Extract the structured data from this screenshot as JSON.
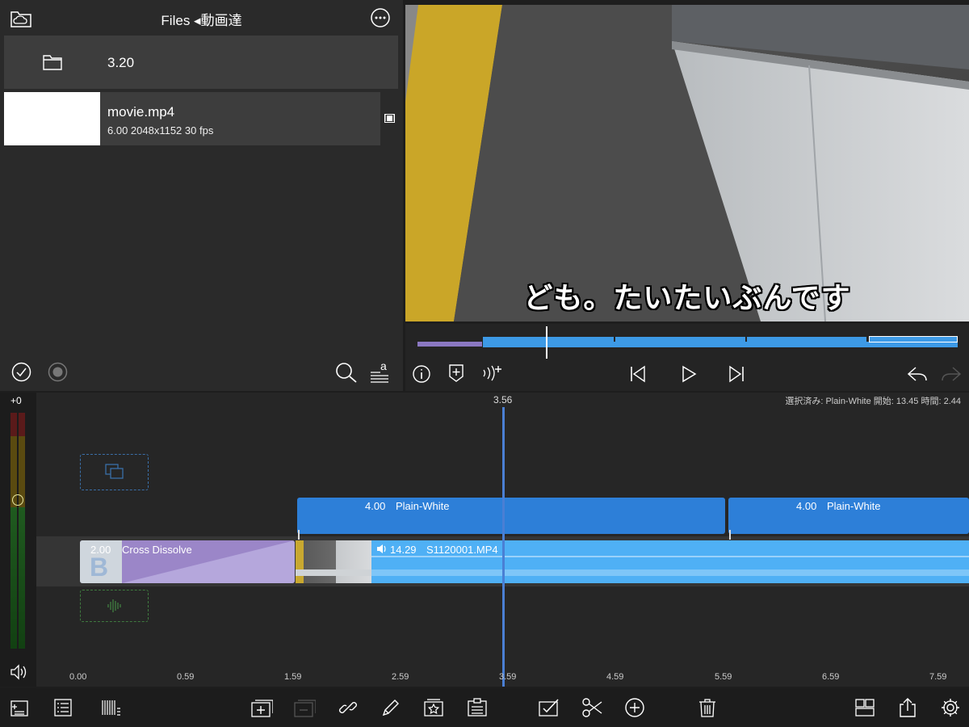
{
  "files": {
    "title": "Files ◂動画達",
    "items": [
      {
        "name": "3.20"
      },
      {
        "name": "movie.mp4",
        "meta": "6.00  2048x1152  30 fps"
      }
    ]
  },
  "viewer": {
    "subtitle": "ども。たいたいぶんです"
  },
  "timeline": {
    "playhead_time": "3.56",
    "selection_info": "選択済み: Plain-White 開始: 13.45 時間: 2.44",
    "level_label": "+0",
    "ruler": [
      "0.00",
      "0.59",
      "1.59",
      "2.59",
      "3.59",
      "4.59",
      "5.59",
      "6.59",
      "7.59"
    ],
    "title_clips": [
      {
        "duration": "4.00",
        "name": "Plain-White"
      },
      {
        "duration": "4.00",
        "name": "Plain-White"
      }
    ],
    "transition": {
      "duration": "2.00",
      "name": "Cross Dissolve"
    },
    "video_clip": {
      "duration": "14.29",
      "name": "S1120001.MP4"
    }
  },
  "colors": {
    "accent_blue": "#2d7fd8",
    "audio_blue": "#4fb0f5",
    "transition_purple": "#9b86c8",
    "playhead": "#4a7fd4"
  }
}
